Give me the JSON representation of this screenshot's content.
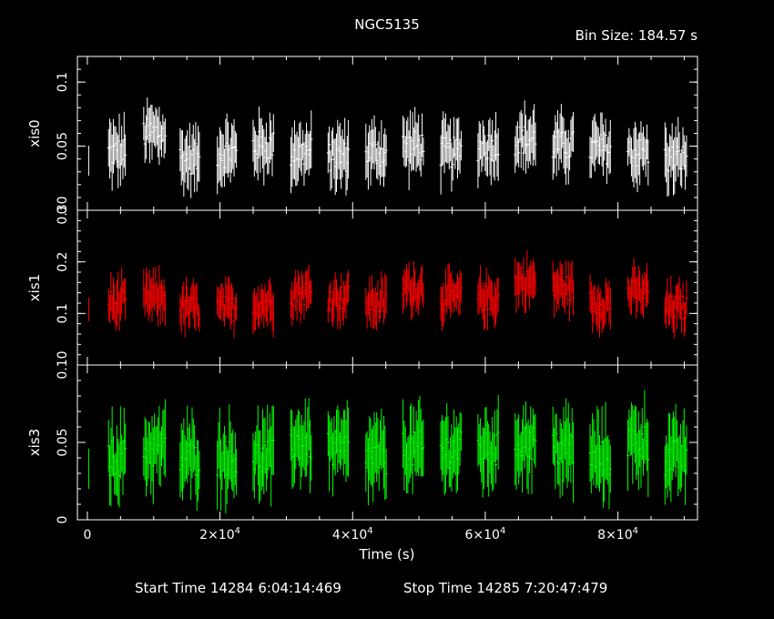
{
  "chart_data": {
    "type": "scatter",
    "title": "NGC5135",
    "bin_size": "Bin Size: 184.57 s",
    "xlabel": "Time (s)",
    "xlim": [
      -1500,
      92000
    ],
    "x_ticks": [
      {
        "value": 0,
        "label": "0"
      },
      {
        "value": 20000,
        "label": "2×10",
        "exp": "4"
      },
      {
        "value": 40000,
        "label": "4×10",
        "exp": "4"
      },
      {
        "value": 60000,
        "label": "6×10",
        "exp": "4"
      },
      {
        "value": 80000,
        "label": "8×10",
        "exp": "4"
      }
    ],
    "start_time": "Start Time 14284  6:04:14:469",
    "stop_time": "Stop Time 14285  7:20:47:479",
    "segments": [
      [
        3200,
        5800
      ],
      [
        8500,
        11800
      ],
      [
        14000,
        17000
      ],
      [
        19600,
        22500
      ],
      [
        25000,
        28200
      ],
      [
        30700,
        33800
      ],
      [
        36300,
        39400
      ],
      [
        42000,
        45200
      ],
      [
        47600,
        50800
      ],
      [
        53300,
        56400
      ],
      [
        58900,
        62000
      ],
      [
        64500,
        67700
      ],
      [
        70200,
        73400
      ],
      [
        75800,
        79000
      ],
      [
        81500,
        84600
      ],
      [
        87100,
        90400
      ]
    ],
    "panels": [
      {
        "name": "xis0",
        "color": "#ffffff",
        "ylim": [
          0,
          0.12
        ],
        "yticks": [
          {
            "value": 0,
            "label": "0"
          },
          {
            "value": 0.05,
            "label": "0.05"
          },
          {
            "value": 0.1,
            "label": "0.1"
          }
        ],
        "segment_means": [
          0.045,
          0.06,
          0.04,
          0.045,
          0.05,
          0.045,
          0.042,
          0.045,
          0.05,
          0.045,
          0.05,
          0.055,
          0.05,
          0.048,
          0.045,
          0.04
        ],
        "noise": 0.012,
        "err": 0.018
      },
      {
        "name": "xis1",
        "color": "#ff0000",
        "ylim": [
          0,
          0.3
        ],
        "yticks": [
          {
            "value": 0.1,
            "label": "0.1"
          },
          {
            "value": 0.2,
            "label": "0.2"
          },
          {
            "value": 0.3,
            "label": "0.30"
          }
        ],
        "segment_means": [
          0.12,
          0.13,
          0.11,
          0.11,
          0.12,
          0.14,
          0.13,
          0.12,
          0.15,
          0.13,
          0.13,
          0.16,
          0.15,
          0.12,
          0.14,
          0.11
        ],
        "noise": 0.025,
        "err": 0.035
      },
      {
        "name": "xis3",
        "color": "#00ff00",
        "ylim": [
          0,
          0.1
        ],
        "yticks": [
          {
            "value": 0,
            "label": "0"
          },
          {
            "value": 0.05,
            "label": "0.05"
          },
          {
            "value": 0.1,
            "label": "0.10"
          }
        ],
        "segment_means": [
          0.04,
          0.045,
          0.04,
          0.04,
          0.04,
          0.05,
          0.045,
          0.04,
          0.045,
          0.045,
          0.045,
          0.05,
          0.045,
          0.04,
          0.05,
          0.04
        ],
        "noise": 0.012,
        "err": 0.02
      }
    ]
  }
}
